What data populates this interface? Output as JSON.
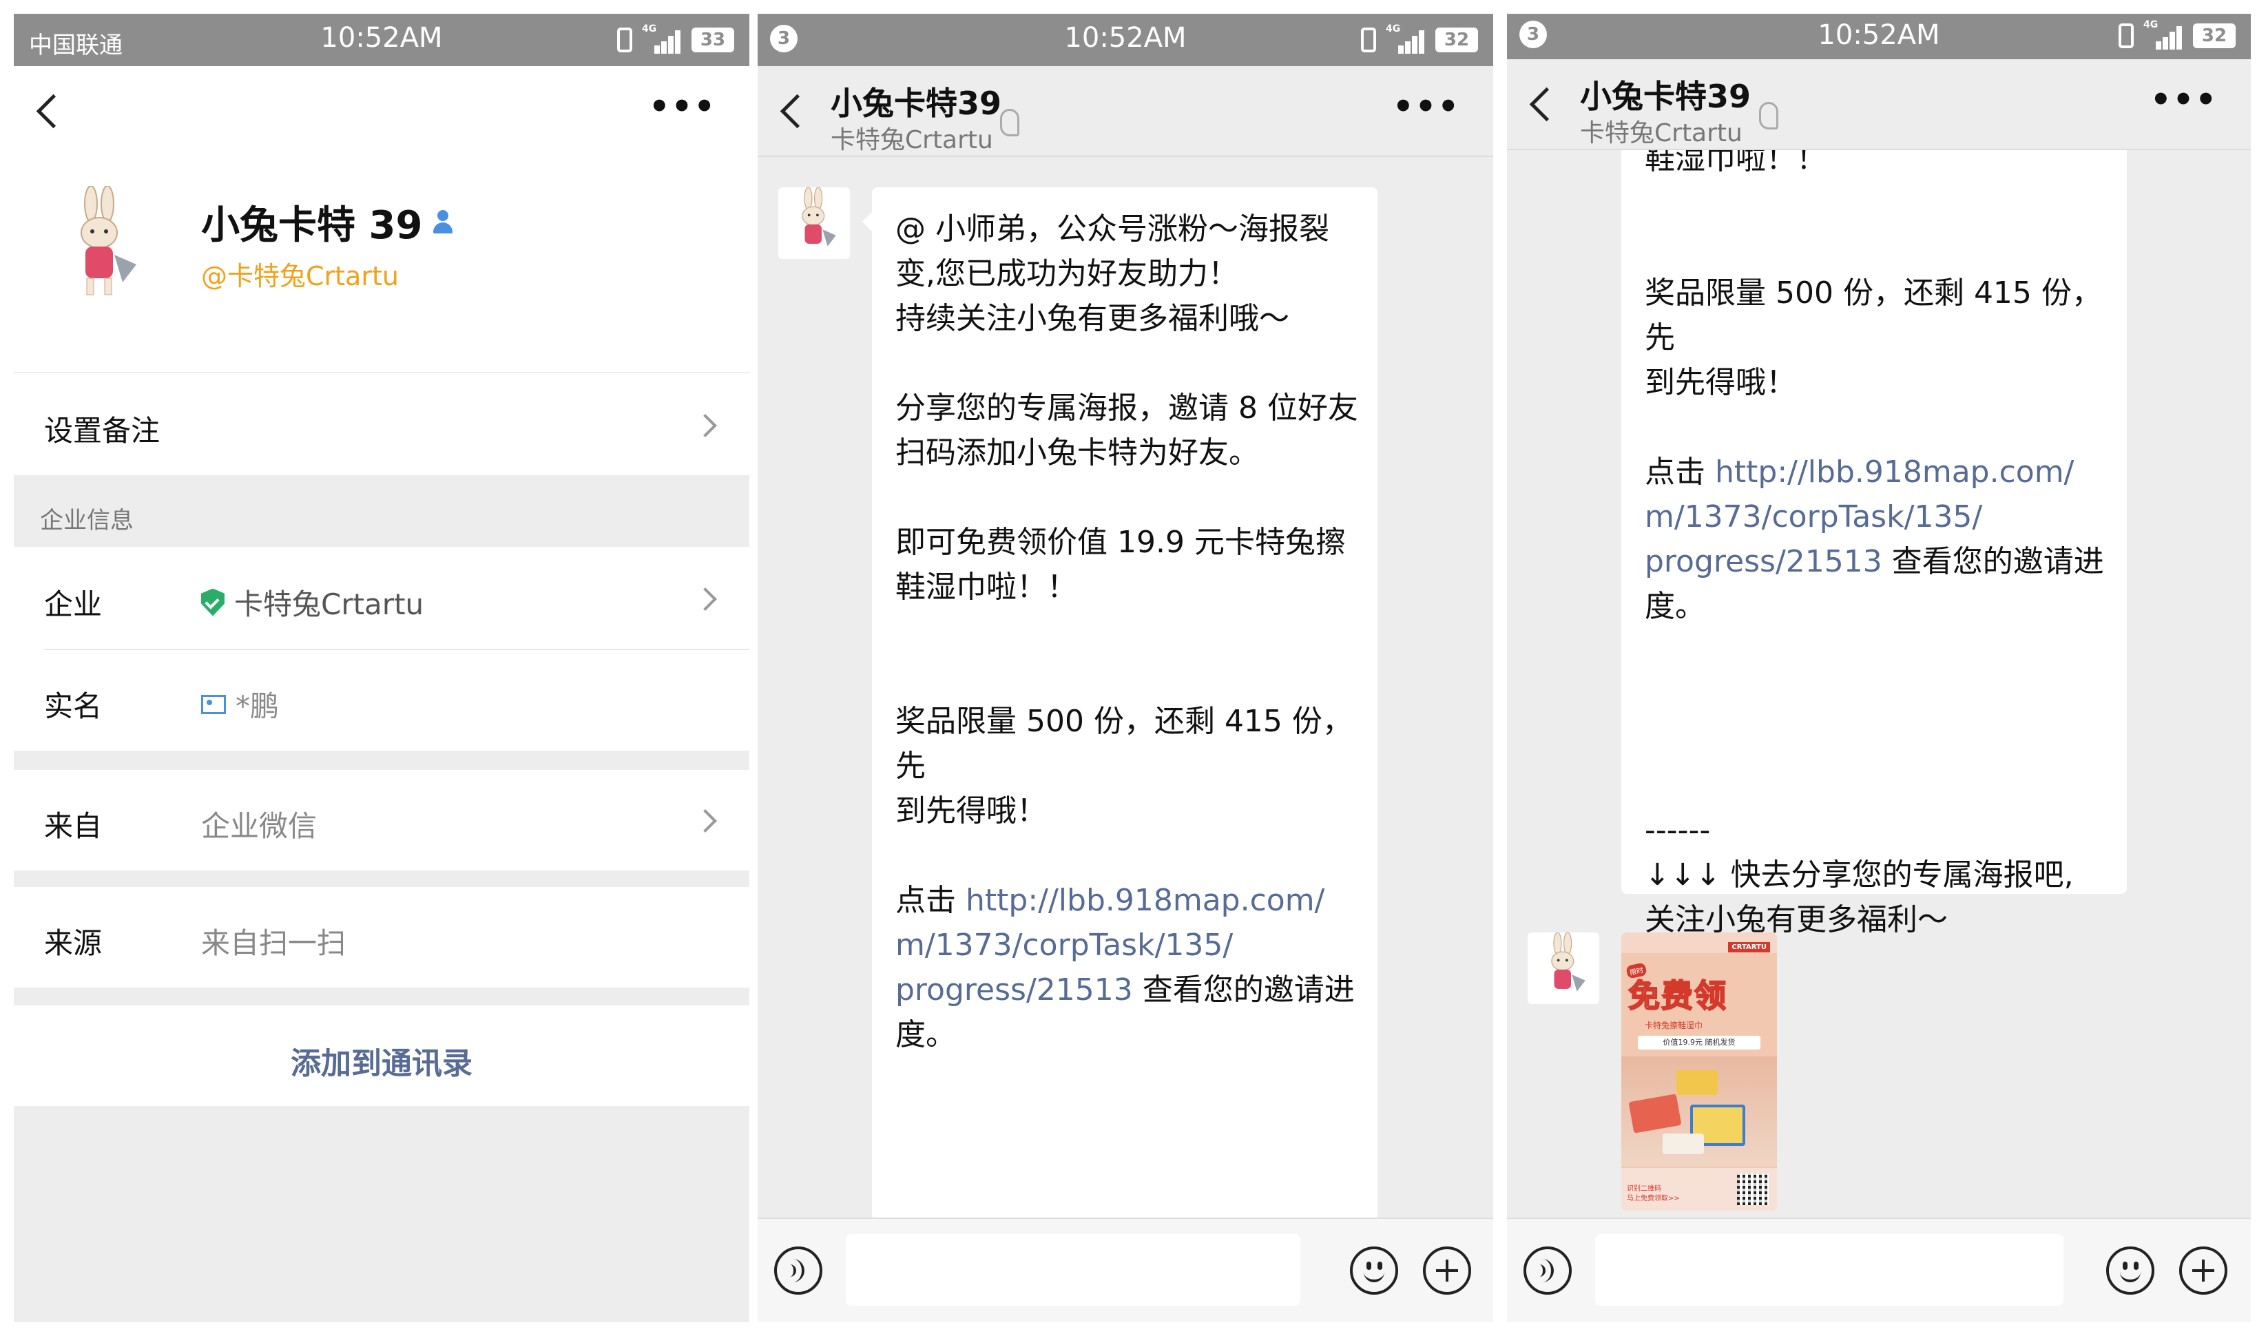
{
  "status_bar": {
    "carrier": "中国联通",
    "time": "10:52AM",
    "badge": "3",
    "network": "4G",
    "battery_left": "33",
    "battery_right": "32"
  },
  "profile_screen": {
    "name": "小兔卡特 39",
    "subtitle": "@卡特兔Crtartu",
    "remark_label": "设置备注",
    "section_title": "企业信息",
    "company_label": "企业",
    "company_value": "卡特兔Crtartu",
    "realname_label": "实名",
    "realname_value": "*鹏",
    "from_label": "来自",
    "from_value": "企业微信",
    "source_label": "来源",
    "source_value": "来自扫一扫",
    "add_button": "添加到通讯录"
  },
  "chat": {
    "title": "小兔卡特39",
    "subtitle": "卡特兔Crtartu",
    "message": {
      "line_01": "@ 小师弟，公众号涨粉～海报裂",
      "line_02": "变,您已成功为好友助力！",
      "line_03": "持续关注小兔有更多福利哦～",
      "line_04": "分享您的专属海报，邀请 8 位好友",
      "line_05": "扫码添加小兔卡特为好友。",
      "line_06": "即可免费领价值 19.9 元卡特兔擦",
      "line_07": "鞋湿巾啦！！",
      "line_08": "奖品限量 500 份，还剩 415 份，先",
      "line_09": "到先得哦！",
      "line_10_prefix": "点击 ",
      "link_1": "http://lbb.918map.com/",
      "link_2": "m/1373/corpTask/135/",
      "link_3": "progress/21513",
      "line_12_suffix": " 查看您的邀请进",
      "line_13": "度。",
      "line_14": "------",
      "line_15": "↓↓↓ 快去分享您的专属海报吧,",
      "line_16": "关注小兔有更多福利～"
    },
    "poster": {
      "title": "免费领",
      "tag": "限时",
      "subtitle": "卡特兔擦鞋湿巾",
      "price": "价值19.9元 随机发货",
      "brand": "CRTARTU",
      "cta_1": "识别二维码",
      "cta_2": "马上免费领取>>"
    }
  },
  "icons": {
    "back": "chevron-left-icon",
    "more": "more-icon",
    "voice": "voice-icon",
    "emoji": "emoji-icon",
    "plus": "plus-icon",
    "verified": "shield-icon",
    "realname": "idcard-icon",
    "contact": "person-icon",
    "earpiece": "ear-icon"
  },
  "colors": {
    "status_bar": "#8d8d8d",
    "background": "#ededed",
    "link": "#576b95",
    "nickname": "#f0a21a",
    "verified": "#2aae67",
    "contact_icon": "#4a90e2"
  }
}
